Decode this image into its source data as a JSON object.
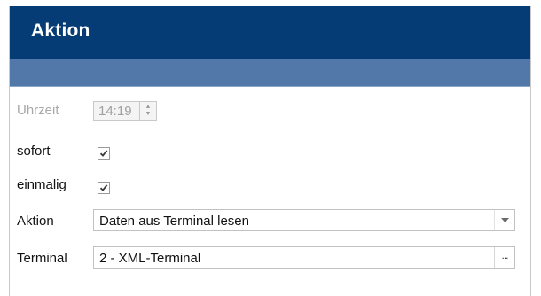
{
  "header": {
    "title": "Aktion"
  },
  "form": {
    "time": {
      "label": "Uhrzeit",
      "value": "14:19",
      "disabled": true
    },
    "immediate": {
      "label": "sofort",
      "checked": true
    },
    "once": {
      "label": "einmalig",
      "checked": true
    },
    "action": {
      "label": "Aktion",
      "value": "Daten aus Terminal lesen"
    },
    "terminal": {
      "label": "Terminal",
      "value": "2 - XML-Terminal",
      "button_label": "..."
    }
  },
  "colors": {
    "header": "#063c75",
    "subheader": "#5178a8",
    "disabled_text": "#a7a7a7"
  }
}
